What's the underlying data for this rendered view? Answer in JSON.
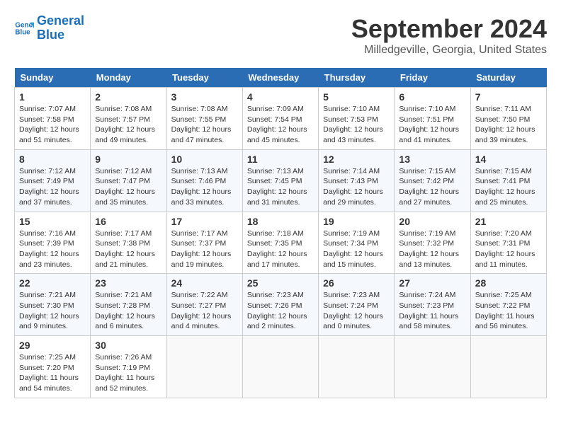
{
  "logo": {
    "line1": "General",
    "line2": "Blue"
  },
  "title": "September 2024",
  "location": "Milledgeville, Georgia, United States",
  "headers": [
    "Sunday",
    "Monday",
    "Tuesday",
    "Wednesday",
    "Thursday",
    "Friday",
    "Saturday"
  ],
  "weeks": [
    [
      {
        "num": "1",
        "info": "Sunrise: 7:07 AM\nSunset: 7:58 PM\nDaylight: 12 hours\nand 51 minutes."
      },
      {
        "num": "2",
        "info": "Sunrise: 7:08 AM\nSunset: 7:57 PM\nDaylight: 12 hours\nand 49 minutes."
      },
      {
        "num": "3",
        "info": "Sunrise: 7:08 AM\nSunset: 7:55 PM\nDaylight: 12 hours\nand 47 minutes."
      },
      {
        "num": "4",
        "info": "Sunrise: 7:09 AM\nSunset: 7:54 PM\nDaylight: 12 hours\nand 45 minutes."
      },
      {
        "num": "5",
        "info": "Sunrise: 7:10 AM\nSunset: 7:53 PM\nDaylight: 12 hours\nand 43 minutes."
      },
      {
        "num": "6",
        "info": "Sunrise: 7:10 AM\nSunset: 7:51 PM\nDaylight: 12 hours\nand 41 minutes."
      },
      {
        "num": "7",
        "info": "Sunrise: 7:11 AM\nSunset: 7:50 PM\nDaylight: 12 hours\nand 39 minutes."
      }
    ],
    [
      {
        "num": "8",
        "info": "Sunrise: 7:12 AM\nSunset: 7:49 PM\nDaylight: 12 hours\nand 37 minutes."
      },
      {
        "num": "9",
        "info": "Sunrise: 7:12 AM\nSunset: 7:47 PM\nDaylight: 12 hours\nand 35 minutes."
      },
      {
        "num": "10",
        "info": "Sunrise: 7:13 AM\nSunset: 7:46 PM\nDaylight: 12 hours\nand 33 minutes."
      },
      {
        "num": "11",
        "info": "Sunrise: 7:13 AM\nSunset: 7:45 PM\nDaylight: 12 hours\nand 31 minutes."
      },
      {
        "num": "12",
        "info": "Sunrise: 7:14 AM\nSunset: 7:43 PM\nDaylight: 12 hours\nand 29 minutes."
      },
      {
        "num": "13",
        "info": "Sunrise: 7:15 AM\nSunset: 7:42 PM\nDaylight: 12 hours\nand 27 minutes."
      },
      {
        "num": "14",
        "info": "Sunrise: 7:15 AM\nSunset: 7:41 PM\nDaylight: 12 hours\nand 25 minutes."
      }
    ],
    [
      {
        "num": "15",
        "info": "Sunrise: 7:16 AM\nSunset: 7:39 PM\nDaylight: 12 hours\nand 23 minutes."
      },
      {
        "num": "16",
        "info": "Sunrise: 7:17 AM\nSunset: 7:38 PM\nDaylight: 12 hours\nand 21 minutes."
      },
      {
        "num": "17",
        "info": "Sunrise: 7:17 AM\nSunset: 7:37 PM\nDaylight: 12 hours\nand 19 minutes."
      },
      {
        "num": "18",
        "info": "Sunrise: 7:18 AM\nSunset: 7:35 PM\nDaylight: 12 hours\nand 17 minutes."
      },
      {
        "num": "19",
        "info": "Sunrise: 7:19 AM\nSunset: 7:34 PM\nDaylight: 12 hours\nand 15 minutes."
      },
      {
        "num": "20",
        "info": "Sunrise: 7:19 AM\nSunset: 7:32 PM\nDaylight: 12 hours\nand 13 minutes."
      },
      {
        "num": "21",
        "info": "Sunrise: 7:20 AM\nSunset: 7:31 PM\nDaylight: 12 hours\nand 11 minutes."
      }
    ],
    [
      {
        "num": "22",
        "info": "Sunrise: 7:21 AM\nSunset: 7:30 PM\nDaylight: 12 hours\nand 9 minutes."
      },
      {
        "num": "23",
        "info": "Sunrise: 7:21 AM\nSunset: 7:28 PM\nDaylight: 12 hours\nand 6 minutes."
      },
      {
        "num": "24",
        "info": "Sunrise: 7:22 AM\nSunset: 7:27 PM\nDaylight: 12 hours\nand 4 minutes."
      },
      {
        "num": "25",
        "info": "Sunrise: 7:23 AM\nSunset: 7:26 PM\nDaylight: 12 hours\nand 2 minutes."
      },
      {
        "num": "26",
        "info": "Sunrise: 7:23 AM\nSunset: 7:24 PM\nDaylight: 12 hours\nand 0 minutes."
      },
      {
        "num": "27",
        "info": "Sunrise: 7:24 AM\nSunset: 7:23 PM\nDaylight: 11 hours\nand 58 minutes."
      },
      {
        "num": "28",
        "info": "Sunrise: 7:25 AM\nSunset: 7:22 PM\nDaylight: 11 hours\nand 56 minutes."
      }
    ],
    [
      {
        "num": "29",
        "info": "Sunrise: 7:25 AM\nSunset: 7:20 PM\nDaylight: 11 hours\nand 54 minutes."
      },
      {
        "num": "30",
        "info": "Sunrise: 7:26 AM\nSunset: 7:19 PM\nDaylight: 11 hours\nand 52 minutes."
      },
      {
        "num": "",
        "info": ""
      },
      {
        "num": "",
        "info": ""
      },
      {
        "num": "",
        "info": ""
      },
      {
        "num": "",
        "info": ""
      },
      {
        "num": "",
        "info": ""
      }
    ]
  ]
}
